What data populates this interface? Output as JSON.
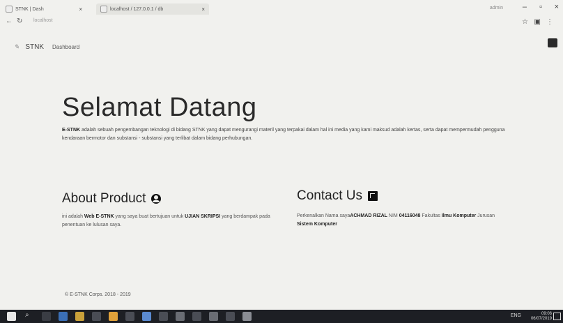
{
  "browser": {
    "tab1_title": "STNK | Dash",
    "tab2_title": "localhost / 127.0.0.1 / db",
    "url": "localhost",
    "window_user": "admin"
  },
  "navbar": {
    "brand": "STNK",
    "dashboard_link": "Dashboard"
  },
  "hero": {
    "title": "Selamat Datang",
    "brand_bold": "E-STNK",
    "text": "adalah sebuah pengembangan teknologi di bidang STNK yang dapat mengurangi materil yang terpakai dalam hal ini media yang kami maksud adalah kertas, serta dapat mempermudah pengguna kendaraan bermotor dan substansi - substansi yang terlibat dalam bidang perhubungan."
  },
  "about": {
    "title": "About Product",
    "text_a": "ini adalah",
    "bold_a": "Web E-STNK",
    "text_b": "yang saya buat bertujuan untuk",
    "bold_b": "UJIAN SKRIPSI",
    "text_c": "yang berdampak pada penentuan ke lulusan saya."
  },
  "contact": {
    "title": "Contact Us",
    "text_a": "Perkenalkan Nama saya",
    "bold_a": "ACHMAD RIZAL",
    "text_b": "NIM",
    "bold_b": "04116048",
    "text_c": "Fakultas",
    "bold_c": "Ilmu Komputer",
    "text_d": "Jurusan",
    "bold_d": "Sistem Komputer"
  },
  "footer": {
    "text": "© E-STNK Corps. 2018 - 2019"
  },
  "taskbar": {
    "tray": "ENG",
    "time": "09:06",
    "date": "06/07/2019"
  }
}
